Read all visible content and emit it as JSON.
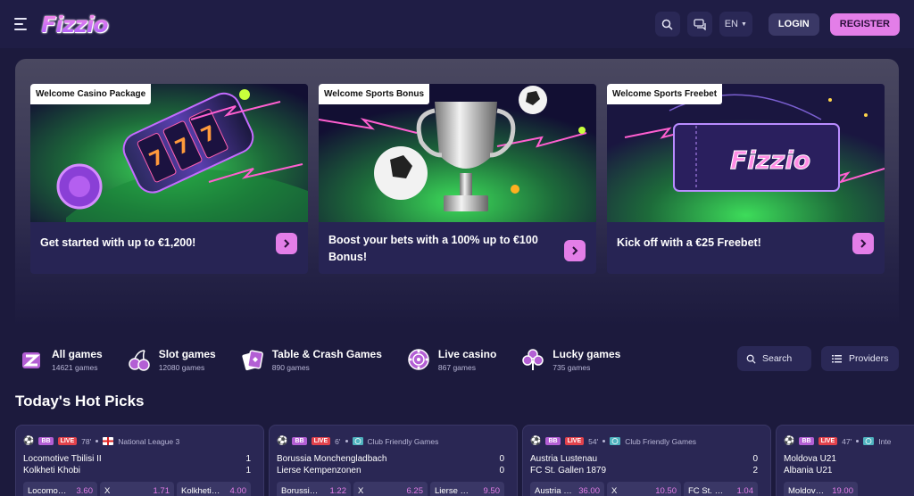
{
  "header": {
    "logo": "Fizzio",
    "lang": "EN",
    "login": "LOGIN",
    "register": "REGISTER"
  },
  "promos": [
    {
      "tag": "Welcome Casino Package",
      "text": "Get started with up to €1,200!"
    },
    {
      "tag": "Welcome Sports Bonus",
      "text": "Boost your bets with a 100% up to €100 Bonus!"
    },
    {
      "tag": "Welcome Sports Freebet",
      "text": "Kick off with a €25 Freebet!"
    }
  ],
  "categories": [
    {
      "name": "All games",
      "count": "14621 games"
    },
    {
      "name": "Slot games",
      "count": "12080 games"
    },
    {
      "name": "Table & Crash Games",
      "count": "890 games"
    },
    {
      "name": "Live casino",
      "count": "867 games"
    },
    {
      "name": "Lucky games",
      "count": "735 games"
    }
  ],
  "search_label": "Search",
  "providers_label": "Providers",
  "section_title": "Today's Hot Picks",
  "matches": [
    {
      "bb": "BB",
      "live": "LIVE",
      "minute": "78'",
      "league": "National League 3",
      "home": "Locomotive Tbilisi II",
      "away": "Kolkheti Khobi",
      "home_score": "1",
      "away_score": "1",
      "odds": [
        {
          "l": "Locomotive Tbilisi II",
          "v": "3.60"
        },
        {
          "l": "X",
          "v": "1.71"
        },
        {
          "l": "Kolkheti Khobi",
          "v": "4.00"
        }
      ]
    },
    {
      "bb": "BB",
      "live": "LIVE",
      "minute": "6'",
      "league": "Club Friendly Games",
      "home": "Borussia Monchengladbach",
      "away": "Lierse Kempenzonen",
      "home_score": "0",
      "away_score": "0",
      "odds": [
        {
          "l": "Borussia Monchengladbach",
          "v": "1.22"
        },
        {
          "l": "X",
          "v": "6.25"
        },
        {
          "l": "Lierse Kempenzonen",
          "v": "9.50"
        }
      ]
    },
    {
      "bb": "BB",
      "live": "LIVE",
      "minute": "54'",
      "league": "Club Friendly Games",
      "home": "Austria Lustenau",
      "away": "FC St. Gallen 1879",
      "home_score": "0",
      "away_score": "2",
      "odds": [
        {
          "l": "Austria Lustenau",
          "v": "36.00"
        },
        {
          "l": "X",
          "v": "10.50"
        },
        {
          "l": "FC St. Gallen 1879",
          "v": "1.04"
        }
      ]
    },
    {
      "bb": "BB",
      "live": "LIVE",
      "minute": "47'",
      "league": "Inte",
      "home": "Moldova U21",
      "away": "Albania U21",
      "home_score": "",
      "away_score": "",
      "odds": [
        {
          "l": "Moldova U21",
          "v": "19.00"
        }
      ]
    }
  ]
}
